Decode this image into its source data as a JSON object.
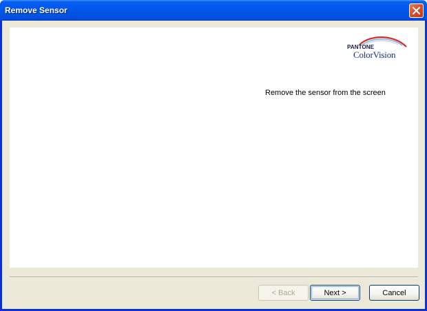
{
  "window": {
    "title": "Remove Sensor"
  },
  "logo": {
    "brand_top": "PANTONE",
    "brand_bottom": "ColorVision"
  },
  "content": {
    "message": "Remove the sensor from the screen"
  },
  "buttons": {
    "back_label": "< Back",
    "next_label": "Next >",
    "cancel_label": "Cancel"
  },
  "icons": {
    "close": "close-icon",
    "logo_swoosh": "logo-swoosh-icon"
  },
  "colors": {
    "titlebar": "#0054e3",
    "close_button": "#d9502d",
    "dialog_background": "#ece9d8",
    "logo_red": "#d42a2a",
    "logo_blue": "#1b2e78"
  }
}
